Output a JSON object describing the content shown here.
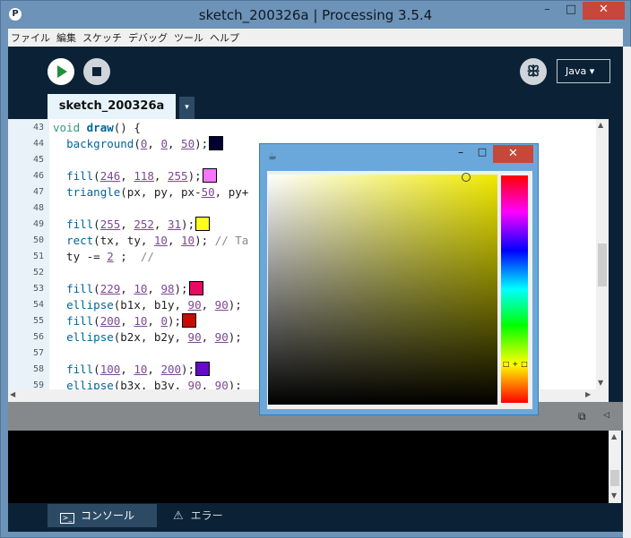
{
  "window": {
    "title": "sketch_200326a | Processing 3.5.4",
    "app_icon": "P"
  },
  "window_controls": {
    "minimize": "–",
    "maximize": "□",
    "close": "✕"
  },
  "menu": [
    "ファイル",
    "編集",
    "スケッチ",
    "デバッグ",
    "ツール",
    "ヘルプ"
  ],
  "toolbar": {
    "mode": "Java ▾"
  },
  "tab": {
    "label": "sketch_200326a",
    "menu_arrow": "▾"
  },
  "editor": {
    "lines": [
      {
        "n": "43",
        "html": "<span class='kw'>void</span> <span class='fnb'>draw</span>() {"
      },
      {
        "n": "44",
        "html": "  <span class='fn'>background</span>(<span class='num'>0</span>, <span class='num'>0</span>, <span class='num'>50</span>);<span class='swatch' style='background:#000032'></span>"
      },
      {
        "n": "45",
        "html": ""
      },
      {
        "n": "46",
        "html": "  <span class='fn'>fill</span>(<span class='num'>246</span>, <span class='num'>118</span>, <span class='num'>255</span>);<span class='swatch' style='background:#f676ff'></span>"
      },
      {
        "n": "47",
        "html": "  <span class='fn'>triangle</span>(px, py, px-<span class='num'>50</span>, py+"
      },
      {
        "n": "48",
        "html": ""
      },
      {
        "n": "49",
        "html": "  <span class='fn'>fill</span>(<span class='num'>255</span>, <span class='num'>252</span>, <span class='num'>31</span>);<span class='swatch' style='background:#fffc1f'></span>"
      },
      {
        "n": "50",
        "html": "  <span class='fn'>rect</span>(tx, ty, <span class='num'>10</span>, <span class='num'>10</span>); <span class='cm'>// Ta</span>"
      },
      {
        "n": "51",
        "html": "  ty -= <span class='num'>2</span> ;  <span class='cm'>//</span>"
      },
      {
        "n": "52",
        "html": ""
      },
      {
        "n": "53",
        "html": "  <span class='fn'>fill</span>(<span class='num'>229</span>, <span class='num'>10</span>, <span class='num'>98</span>);<span class='swatch' style='background:#e50a62'></span>"
      },
      {
        "n": "54",
        "html": "  <span class='fn'>ellipse</span>(b1x, b1y, <span class='num'>90</span>, <span class='num'>90</span>);"
      },
      {
        "n": "55",
        "html": "  <span class='fn'>fill</span>(<span class='num'>200</span>, <span class='num'>10</span>, <span class='num'>0</span>);<span class='swatch' style='background:#c80a00'></span>"
      },
      {
        "n": "56",
        "html": "  <span class='fn'>ellipse</span>(b2x, b2y, <span class='num'>90</span>, <span class='num'>90</span>);"
      },
      {
        "n": "57",
        "html": ""
      },
      {
        "n": "58",
        "html": "  <span class='fn'>fill</span>(<span class='num'>100</span>, <span class='num'>10</span>, <span class='num'>200</span>);<span class='swatch' style='background:#640ac8'></span>"
      },
      {
        "n": "59",
        "html": "  <span class='fn'>ellipse</span>(b3x, b3y, <span class='num'>90</span>, <span class='num'>90</span>);"
      }
    ]
  },
  "bottom_tabs": {
    "console": "コンソール",
    "errors": "エラー"
  },
  "color_picker": {
    "close": "✕",
    "minimize": "–",
    "maximize": "□",
    "hue_marker": "□+□"
  },
  "colors": {
    "accent_close": "#c7473b",
    "pde_bg": "#0b2236",
    "tab_bg": "#e8f4fb"
  }
}
